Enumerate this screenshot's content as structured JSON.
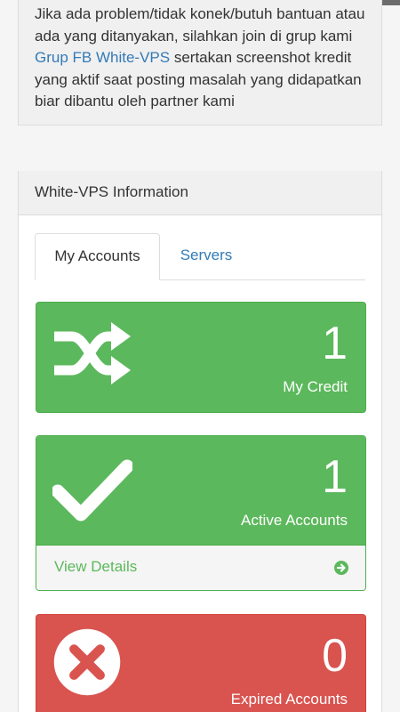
{
  "notice": {
    "text_before": "Jika ada problem/tidak konek/butuh bantuan atau ada yang ditanyakan, silahkan join di grup kami ",
    "link_text": "Grup FB White-VPS",
    "text_after": " sertakan screenshot kredit yang aktif saat posting masalah yang didapatkan biar dibantu oleh partner kami"
  },
  "panel": {
    "title": "White-VPS Information"
  },
  "tabs": [
    {
      "label": "My Accounts",
      "active": true
    },
    {
      "label": "Servers",
      "active": false
    }
  ],
  "cards": {
    "credit": {
      "value": "1",
      "label": "My Credit",
      "icon": "shuffle-icon",
      "color": "#5cb85c"
    },
    "active": {
      "value": "1",
      "label": "Active Accounts",
      "icon": "check-icon",
      "color": "#5cb85c",
      "details_label": "View Details"
    },
    "expired": {
      "value": "0",
      "label": "Expired Accounts",
      "icon": "times-circle-icon",
      "color": "#d9534f"
    }
  }
}
